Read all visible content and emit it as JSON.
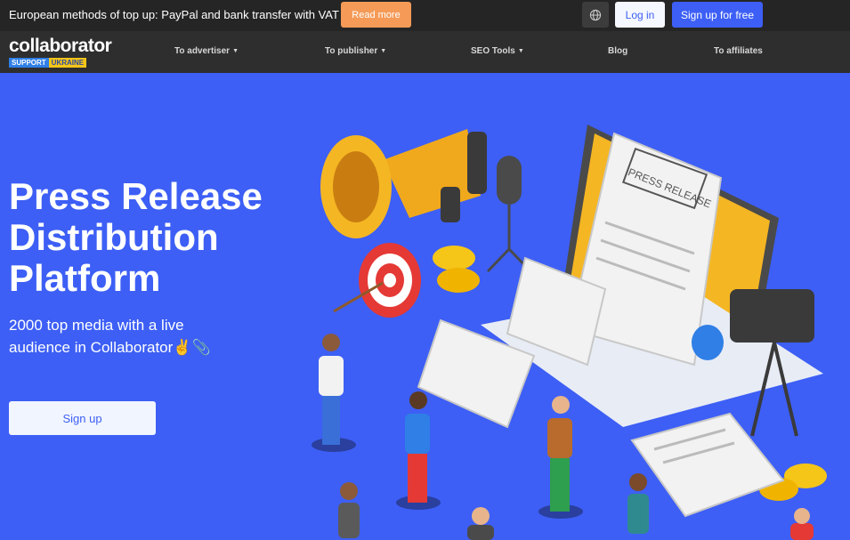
{
  "topbar": {
    "promo_text": "European methods of top up: PayPal and bank transfer with VAT",
    "read_more": "Read more",
    "globe_icon": "globe-icon",
    "login": "Log in",
    "signup_free": "Sign up for free"
  },
  "nav": {
    "logo_text": "collaborator",
    "logo_badge_support": "SUPPORT",
    "logo_badge_ukraine": "UKRAINE",
    "items": [
      {
        "label": "To advertiser",
        "has_dropdown": true
      },
      {
        "label": "To publisher",
        "has_dropdown": true
      },
      {
        "label": "SEO Tools",
        "has_dropdown": true
      },
      {
        "label": "Blog",
        "has_dropdown": false
      },
      {
        "label": "To affiliates",
        "has_dropdown": false
      }
    ]
  },
  "hero": {
    "title_line1": "Press Release",
    "title_line2": "Distribution",
    "title_line3": "Platform",
    "subtitle_line1": "2000 top media with a live",
    "subtitle_line2": "audience in Collaborator✌️📎",
    "signup": "Sign up",
    "illustration_text": "PRESS RELEASE"
  },
  "colors": {
    "hero_background": "#3d5ff5",
    "topbar_background": "#252525",
    "navbar_background": "#2e2e2e",
    "accent_orange": "#f59a57",
    "accent_blue": "#3d5ff5"
  }
}
